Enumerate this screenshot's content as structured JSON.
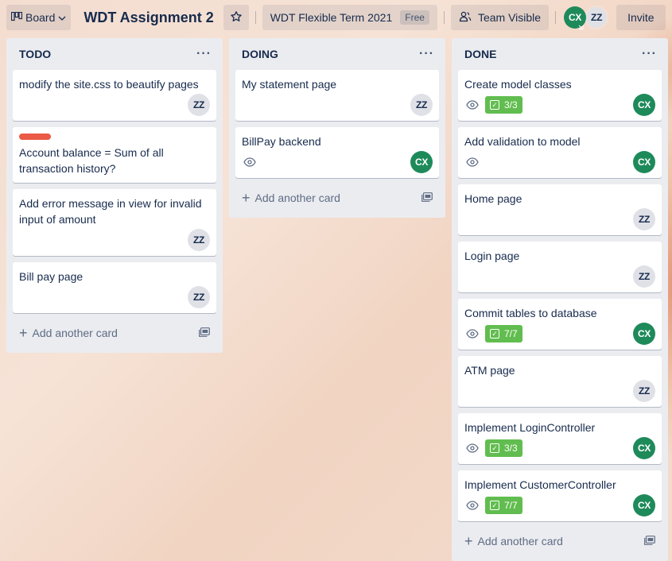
{
  "header": {
    "board_btn_label": "Board",
    "board_title": "WDT Assignment 2",
    "workspace_name": "WDT Flexible Term 2021",
    "workspace_badge": "Free",
    "visibility_label": "Team Visible",
    "members": [
      {
        "initials": "CX",
        "color": "#1e8a5a"
      },
      {
        "initials": "ZZ",
        "color": "#dfe1e6"
      }
    ],
    "invite_label": "Invite"
  },
  "add_card_label": "Add another card",
  "lists": [
    {
      "title": "TODO",
      "cards": [
        {
          "title": "modify the site.css to beautify pages",
          "member": "ZZ"
        },
        {
          "title": "Account balance = Sum of all transaction history?",
          "label_color": "#eb5a46"
        },
        {
          "title": "Add error message in view for invalid input of amount",
          "member": "ZZ"
        },
        {
          "title": "Bill pay page",
          "member": "ZZ"
        }
      ]
    },
    {
      "title": "DOING",
      "cards": [
        {
          "title": "My statement page",
          "member": "ZZ"
        },
        {
          "title": "BillPay backend",
          "member": "CX",
          "watching": true
        }
      ]
    },
    {
      "title": "DONE",
      "cards": [
        {
          "title": "Create model classes",
          "member": "CX",
          "watching": true,
          "checklist": "3/3"
        },
        {
          "title": "Add validation to model",
          "member": "CX",
          "watching": true
        },
        {
          "title": "Home page",
          "member": "ZZ"
        },
        {
          "title": "Login page",
          "member": "ZZ"
        },
        {
          "title": "Commit tables to database",
          "member": "CX",
          "watching": true,
          "checklist": "7/7"
        },
        {
          "title": "ATM page",
          "member": "ZZ"
        },
        {
          "title": "Implement LoginController",
          "member": "CX",
          "watching": true,
          "checklist": "3/3"
        },
        {
          "title": "Implement CustomerController",
          "member": "CX",
          "watching": true,
          "checklist": "7/7"
        }
      ]
    }
  ],
  "colors": {
    "checklist_complete": "#61bd4f",
    "label_red": "#eb5a46",
    "list_bg": "#ebecf0"
  }
}
